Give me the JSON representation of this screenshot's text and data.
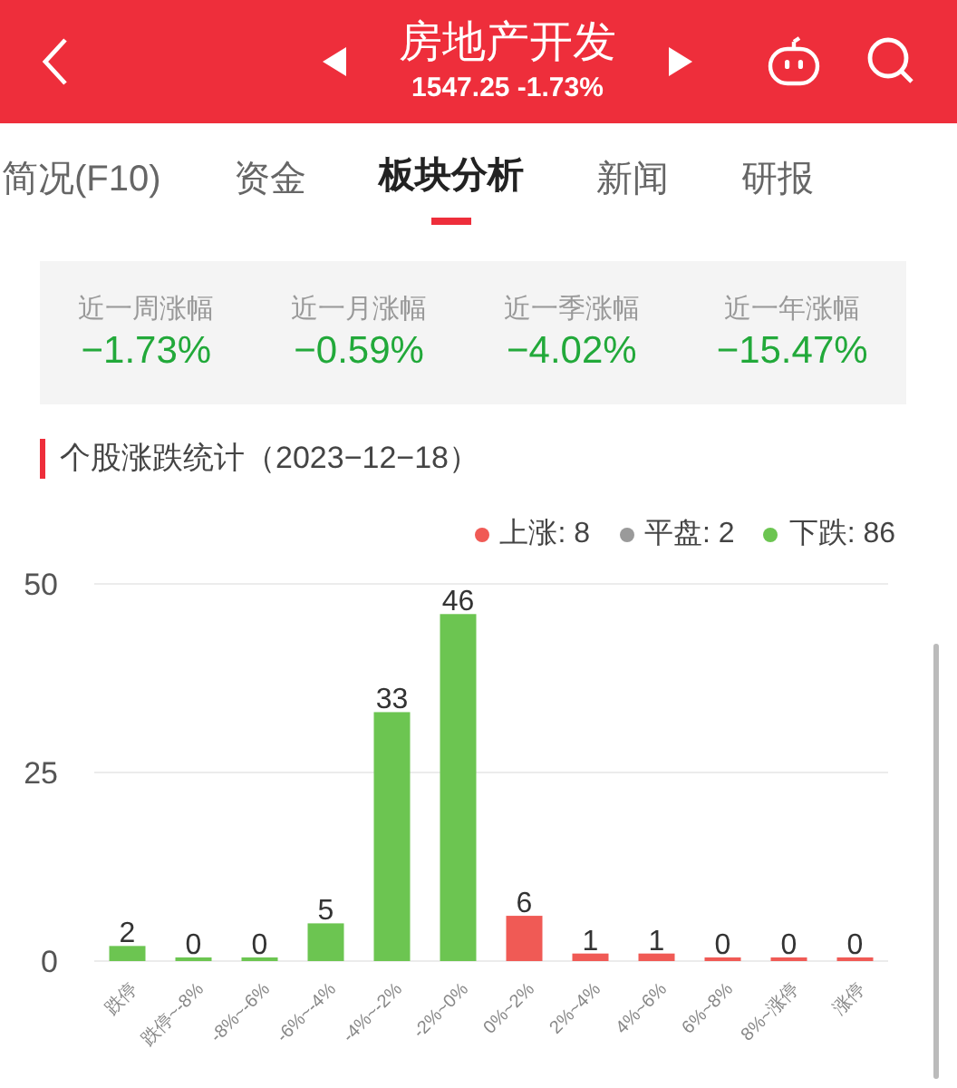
{
  "header": {
    "title": "房地产开发",
    "quote": "1547.25 -1.73%"
  },
  "tabs": [
    {
      "label": "简况(F10)",
      "selected": false
    },
    {
      "label": "资金",
      "selected": false
    },
    {
      "label": "板块分析",
      "selected": true
    },
    {
      "label": "新闻",
      "selected": false
    },
    {
      "label": "研报",
      "selected": false
    }
  ],
  "stats": [
    {
      "label": "近一周涨幅",
      "value": "−1.73%"
    },
    {
      "label": "近一月涨幅",
      "value": "−0.59%"
    },
    {
      "label": "近一季涨幅",
      "value": "−4.02%"
    },
    {
      "label": "近一年涨幅",
      "value": "−15.47%"
    }
  ],
  "section_title": "个股涨跌统计（2023−12−18）",
  "legend": [
    {
      "label": "上涨: 8",
      "color": "#f05a55"
    },
    {
      "label": "平盘: 2",
      "color": "#9a9a9a"
    },
    {
      "label": "下跌: 86",
      "color": "#6cc551"
    }
  ],
  "chart_data": {
    "type": "bar",
    "data_labels": true,
    "categories": [
      "跌停",
      "跌停~-8%",
      "-8%~-6%",
      "-6%~-4%",
      "-4%~-2%",
      "-2%~0%",
      "0%~2%",
      "2%~4%",
      "4%~6%",
      "6%~8%",
      "8%~涨停",
      "涨停"
    ],
    "series": [
      {
        "color": "#6cc551",
        "values": [
          2,
          0,
          0,
          5,
          33,
          46,
          null,
          null,
          null,
          null,
          null,
          null
        ]
      },
      {
        "color": "#f05a55",
        "values": [
          null,
          null,
          null,
          null,
          null,
          null,
          6,
          1,
          1,
          0,
          0,
          0
        ]
      }
    ],
    "ylim": [
      0,
      50
    ],
    "yticks": [
      0,
      25,
      50
    ]
  }
}
